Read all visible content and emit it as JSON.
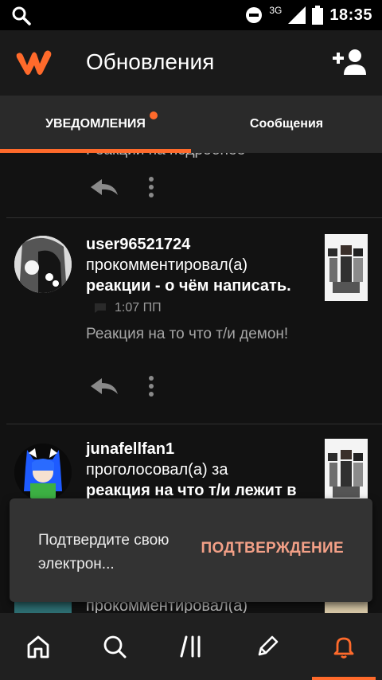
{
  "status_bar": {
    "network": "3G",
    "time": "18:35",
    "icons": [
      "search-icon",
      "do-not-disturb-icon",
      "signal-icon",
      "battery-icon"
    ]
  },
  "app_bar": {
    "title": "Обновления",
    "logo": "wattpad-logo",
    "action_icon": "add-user-icon"
  },
  "tabs": [
    {
      "label": "УВЕДОМЛЕНИЯ",
      "active": true,
      "badge": true
    },
    {
      "label": "Сообщения",
      "active": false,
      "badge": false
    }
  ],
  "feed": {
    "partial_top_text": "Реакции на подробнее",
    "notifications": [
      {
        "username": "user96521724",
        "action": "прокомментировал(а)",
        "story": "реакции - о чём написать.",
        "time": "1:07 ПП",
        "comment": "Реакция на то что т/и демон!"
      },
      {
        "username": "junafellfan1",
        "action": "проголосовал(а) за",
        "story": "реакция на что т/и лежит в"
      }
    ],
    "partial_bottom_text": "прокомментировал(а)"
  },
  "snackbar": {
    "message": "Подтвердите свою электрон...",
    "button": "ПОДТВЕРЖДЕНИЕ"
  },
  "bottom_nav": [
    {
      "icon": "home-icon",
      "active": false
    },
    {
      "icon": "search-icon",
      "active": false
    },
    {
      "icon": "library-icon",
      "active": false
    },
    {
      "icon": "pencil-icon",
      "active": false
    },
    {
      "icon": "bell-icon",
      "active": true
    }
  ],
  "colors": {
    "accent": "#ff6a2b",
    "background": "#121212",
    "snackbar_button": "#f3a087"
  }
}
